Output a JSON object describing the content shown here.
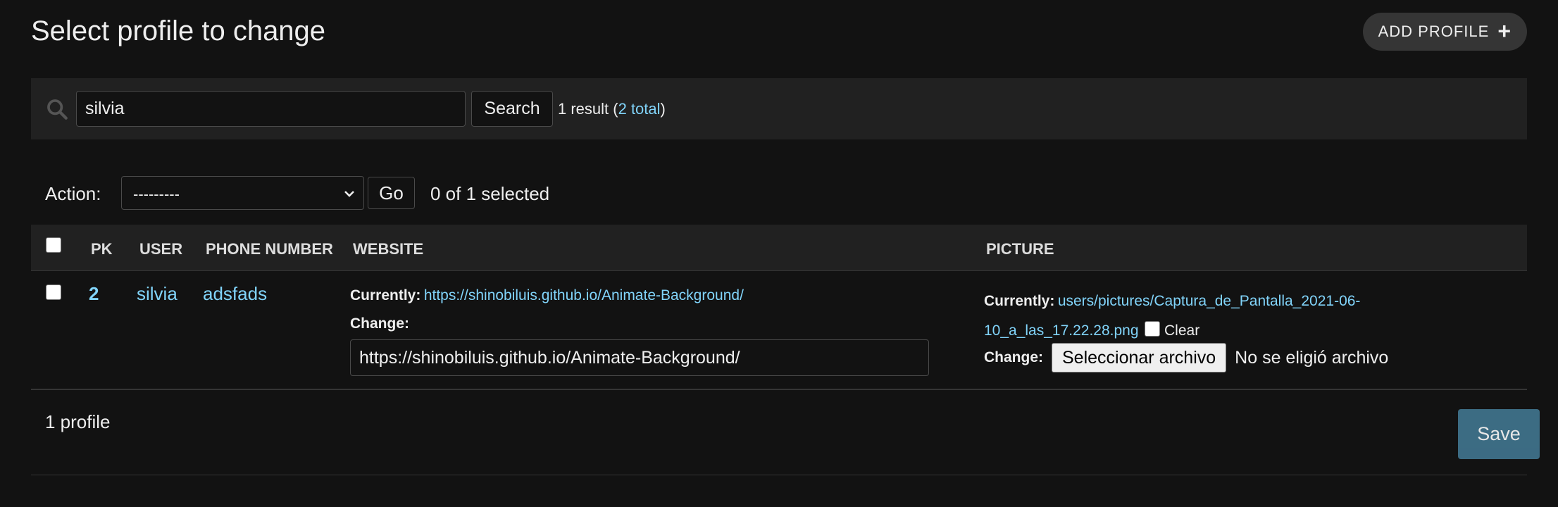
{
  "header": {
    "title": "Select profile to change",
    "add_button": "ADD PROFILE",
    "add_icon": "+"
  },
  "search": {
    "value": "silvia",
    "button": "Search",
    "result_prefix": "1 result (",
    "total_link": "2 total",
    "result_suffix": ")"
  },
  "actions": {
    "label": "Action:",
    "selected_option": "---------",
    "go_button": "Go",
    "selected_count": "0 of 1 selected"
  },
  "table": {
    "columns": [
      "PK",
      "USER",
      "PHONE NUMBER",
      "WEBSITE",
      "PICTURE"
    ],
    "rows": [
      {
        "pk": "2",
        "user": "silvia",
        "phone_number": "adsfads",
        "website": {
          "currently_label": "Currently:",
          "currently_value": "https://shinobiluis.github.io/Animate-Background/",
          "change_label": "Change:",
          "input_value": "https://shinobiluis.github.io/Animate-Background/"
        },
        "picture": {
          "currently_label": "Currently:",
          "currently_value": "users/pictures/Captura_de_Pantalla_2021-06-10_a_las_17.22.28.png",
          "clear_label": "Clear",
          "change_label": "Change:",
          "file_button": "Seleccionar archivo",
          "no_file_text": "No se eligió archivo"
        }
      }
    ]
  },
  "footer": {
    "count": "1 profile",
    "save_button": "Save"
  },
  "colors": {
    "background": "#121212",
    "panel": "#212121",
    "link": "#81d4fa",
    "save": "#417690"
  }
}
